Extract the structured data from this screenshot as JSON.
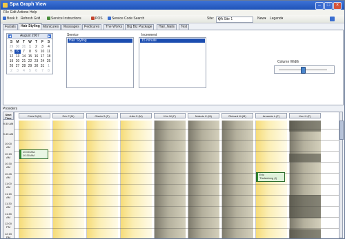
{
  "window": {
    "title": "Spa Graph View"
  },
  "menu": [
    "File",
    "Edit",
    "Actions",
    "Help"
  ],
  "toolbar": {
    "book_it": "Book It",
    "refresh_grid": "Refresh Grid",
    "service_instructions": "Service Instructions",
    "pos": "POS",
    "service_code_search": "Service Code Search",
    "site_label": "Site:",
    "site_value": "QA Site 1",
    "new_label": "New",
    "legend_label": "Legend"
  },
  "tabs": [
    "Facials",
    "Hair Styling",
    "Manicures",
    "Massages",
    "Pedicures",
    "The Works",
    "Big Biz Package",
    "Hair_Nails",
    "Test"
  ],
  "active_tab": 1,
  "calendar": {
    "month_label": "August 2007",
    "dow": [
      "S",
      "M",
      "T",
      "W",
      "T",
      "F",
      "S"
    ],
    "weeks": [
      [
        "29",
        "30",
        "31",
        "1",
        "2",
        "3",
        "4"
      ],
      [
        "5",
        "6",
        "7",
        "8",
        "9",
        "10",
        "11"
      ],
      [
        "12",
        "13",
        "14",
        "15",
        "16",
        "17",
        "18"
      ],
      [
        "19",
        "20",
        "21",
        "22",
        "23",
        "24",
        "25"
      ],
      [
        "26",
        "27",
        "28",
        "29",
        "30",
        "31",
        "1"
      ],
      [
        "2",
        "3",
        "4",
        "5",
        "6",
        "7",
        "8"
      ]
    ],
    "selected": "6"
  },
  "service": {
    "label": "Service",
    "selected_item": "Hair Styling"
  },
  "increment": {
    "label": "Increment",
    "selected_item": "15 minute"
  },
  "column_width_label": "Column Width",
  "column_width_level": 0.5,
  "providers_label": "Providers",
  "start_time_label": "Start Time",
  "providers": [
    {
      "name": "Chris B.(M)",
      "shade": "gold"
    },
    {
      "name": "Eric F.(M)",
      "shade": "gold"
    },
    {
      "name": "Gisela S.(F)",
      "shade": "gold"
    },
    {
      "name": "Julia C.(M)",
      "shade": "gold"
    },
    {
      "name": "Kim W.(F)",
      "shade": "grey"
    },
    {
      "name": "Makoto K.(M)",
      "shade": "grey"
    },
    {
      "name": "Richard M.(M)",
      "shade": "grey"
    },
    {
      "name": "Amanda L.(F)",
      "shade": "gold"
    },
    {
      "name": "Ken H.(F)",
      "shade": "grey"
    }
  ],
  "times": [
    "9:30 AM",
    "9:45 AM",
    "10:00 AM",
    "10:15 AM",
    "10:30 AM",
    "10:45 AM",
    "11:00 AM",
    "11:15 AM",
    "11:30 AM",
    "11:45 AM",
    "12:00 PM",
    "12:15 PM"
  ],
  "appointments": [
    {
      "line1": "10:00 AM-",
      "line2": "10:30 AM"
    },
    {
      "line1": "Eric",
      "line2": "Thulenberg (I)"
    }
  ]
}
